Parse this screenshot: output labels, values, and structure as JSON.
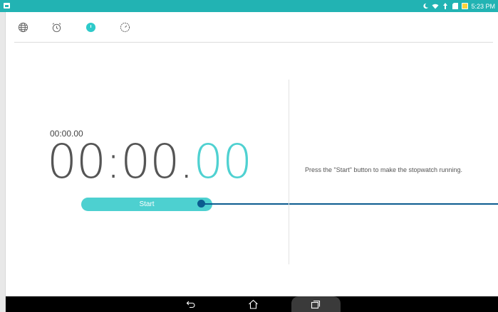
{
  "status_bar": {
    "time": "5:23 PM",
    "icons": [
      "notification-icon",
      "moon-icon",
      "wifi-icon",
      "signal-icon",
      "sd-card-icon",
      "battery-charging-icon"
    ]
  },
  "tabs": [
    {
      "name": "world-clock",
      "icon": "globe-icon"
    },
    {
      "name": "alarm",
      "icon": "alarm-clock-icon"
    },
    {
      "name": "stopwatch",
      "icon": "stopwatch-icon",
      "active": true
    },
    {
      "name": "timer",
      "icon": "timer-icon"
    }
  ],
  "stopwatch": {
    "lap_time": "00:00.00",
    "main_time": "00:00.",
    "hundredths": "00",
    "start_label": "Start",
    "hint": "Press the \"Start\" button to make the stopwatch running."
  },
  "colors": {
    "status_bar": "#22b3b3",
    "accent": "#4dd0d0",
    "annotation": "#0b5b8f"
  }
}
